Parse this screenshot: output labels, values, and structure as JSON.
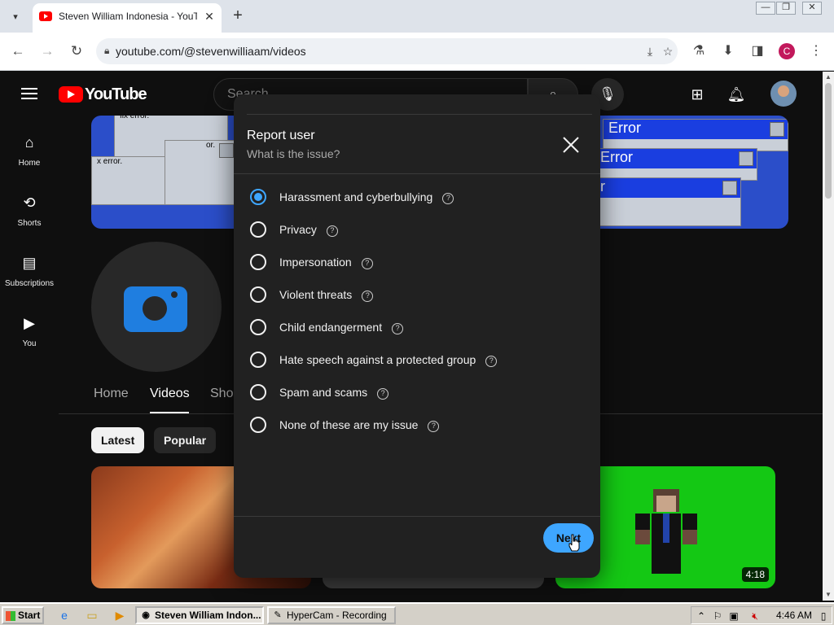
{
  "browser": {
    "tab_title": "Steven William Indonesia - YouTube",
    "url": "youtube.com/@stevenwilliaam/videos",
    "profile_initial": "C",
    "new_tab_symbol": "+",
    "tab_close_symbol": "✕"
  },
  "youtube": {
    "logo_text": "YouTube",
    "search_placeholder": "Search",
    "sidebar": [
      {
        "label": "Home",
        "icon": "home-icon",
        "glyph": "⌂"
      },
      {
        "label": "Shorts",
        "icon": "shorts-icon",
        "glyph": "⟲"
      },
      {
        "label": "Subscriptions",
        "icon": "subscriptions-icon",
        "glyph": "▤"
      },
      {
        "label": "You",
        "icon": "you-icon",
        "glyph": "▶"
      }
    ],
    "banner_texts": [
      "fix error.",
      "x error.",
      "or.",
      "Error",
      "Error",
      "r"
    ],
    "channel_tabs": [
      "Home",
      "Videos",
      "Shorts"
    ],
    "active_tab": "Videos",
    "chips": [
      "Latest",
      "Popular"
    ],
    "active_chip": "Latest",
    "video_duration": "4:18"
  },
  "modal": {
    "title": "Report user",
    "subtitle": "What is the issue?",
    "options": [
      {
        "label": "Harassment and cyberbullying",
        "checked": true
      },
      {
        "label": "Privacy",
        "checked": false
      },
      {
        "label": "Impersonation",
        "checked": false
      },
      {
        "label": "Violent threats",
        "checked": false
      },
      {
        "label": "Child endangerment",
        "checked": false
      },
      {
        "label": "Hate speech against a protected group",
        "checked": false
      },
      {
        "label": "Spam and scams",
        "checked": false
      },
      {
        "label": "None of these are my issue",
        "checked": false
      }
    ],
    "help_symbol": "?",
    "next_label": "Next",
    "accent_color": "#3ea6ff"
  },
  "taskbar": {
    "start_label": "Start",
    "tasks": [
      "Steven William Indon...",
      "HyperCam - Recording"
    ],
    "clock": "4:46 AM"
  }
}
